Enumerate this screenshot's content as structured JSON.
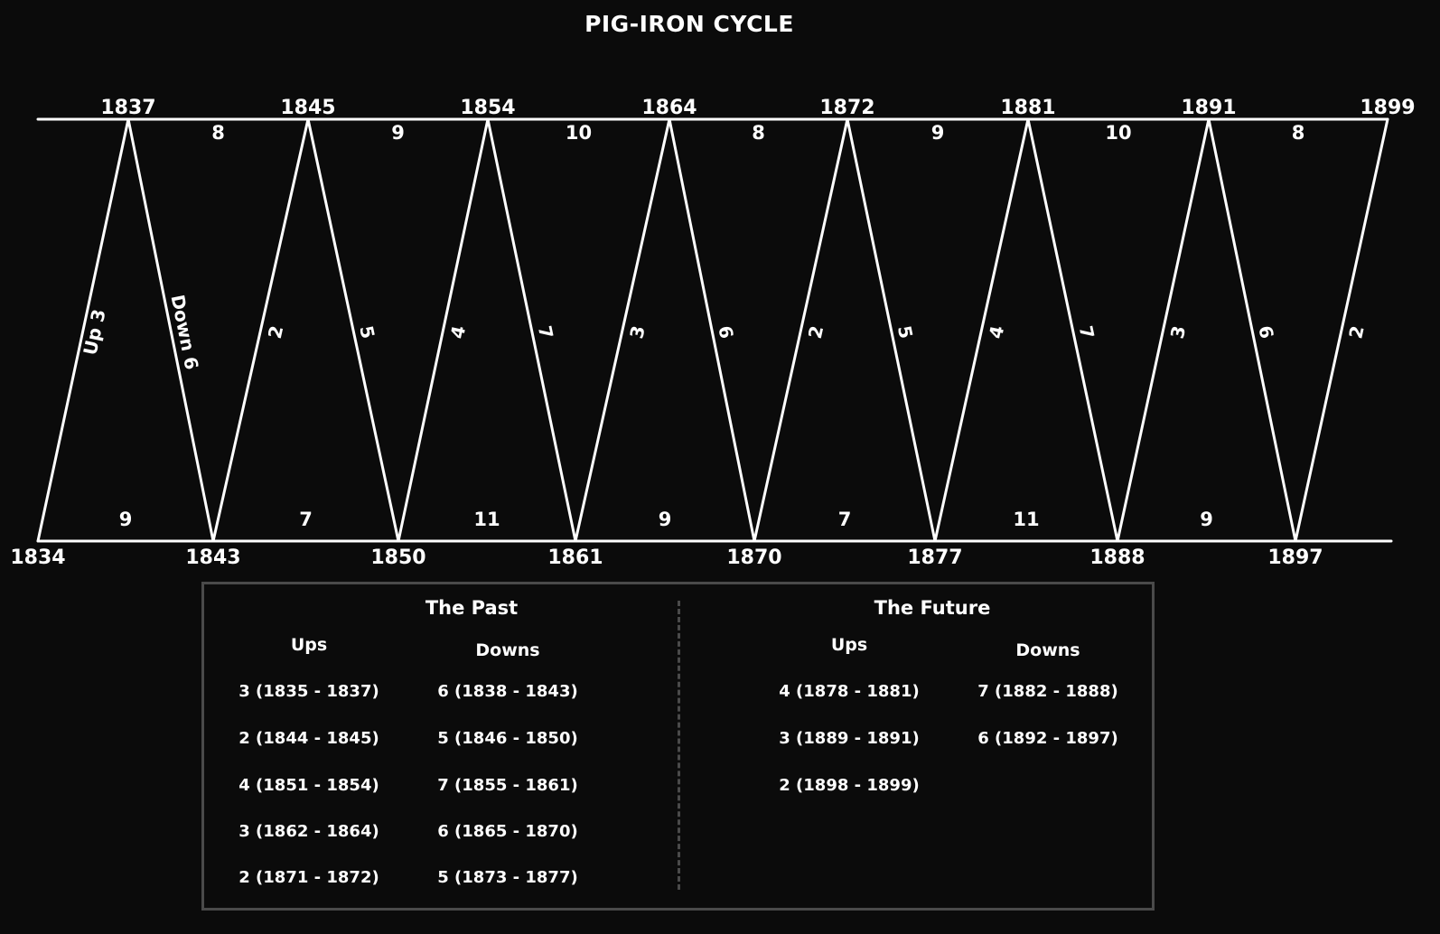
{
  "title": "PIG-IRON CYCLE",
  "diagram": {
    "peaks": [
      "1837",
      "1845",
      "1854",
      "1864",
      "1872",
      "1881",
      "1891",
      "1899"
    ],
    "troughs": [
      "1834",
      "1843",
      "1850",
      "1861",
      "1870",
      "1877",
      "1888",
      "1897"
    ],
    "peak_intervals": [
      "8",
      "9",
      "10",
      "8",
      "9",
      "10",
      "8"
    ],
    "trough_intervals": [
      "9",
      "7",
      "11",
      "9",
      "7",
      "11",
      "9"
    ],
    "legs": [
      "Up 3",
      "Down 6",
      "2",
      "5",
      "4",
      "7",
      "3",
      "6",
      "2",
      "5",
      "4",
      "7",
      "3",
      "6",
      "2"
    ]
  },
  "legend": {
    "past": {
      "title": "The Past",
      "ups_header": "Ups",
      "downs_header": "Downs",
      "ups": [
        "3 (1835 - 1837)",
        "2 (1844 - 1845)",
        "4 (1851 - 1854)",
        "3 (1862 - 1864)",
        "2 (1871 - 1872)"
      ],
      "downs": [
        "6 (1838 - 1843)",
        "5 (1846 - 1850)",
        "7 (1855 - 1861)",
        "6 (1865 - 1870)",
        "5 (1873 - 1877)"
      ]
    },
    "future": {
      "title": "The Future",
      "ups_header": "Ups",
      "downs_header": "Downs",
      "ups": [
        "4 (1878 - 1881)",
        "3 (1889 - 1891)",
        "2 (1898 - 1899)"
      ],
      "downs": [
        "7 (1882 - 1888)",
        "6 (1892 - 1897)"
      ]
    }
  }
}
